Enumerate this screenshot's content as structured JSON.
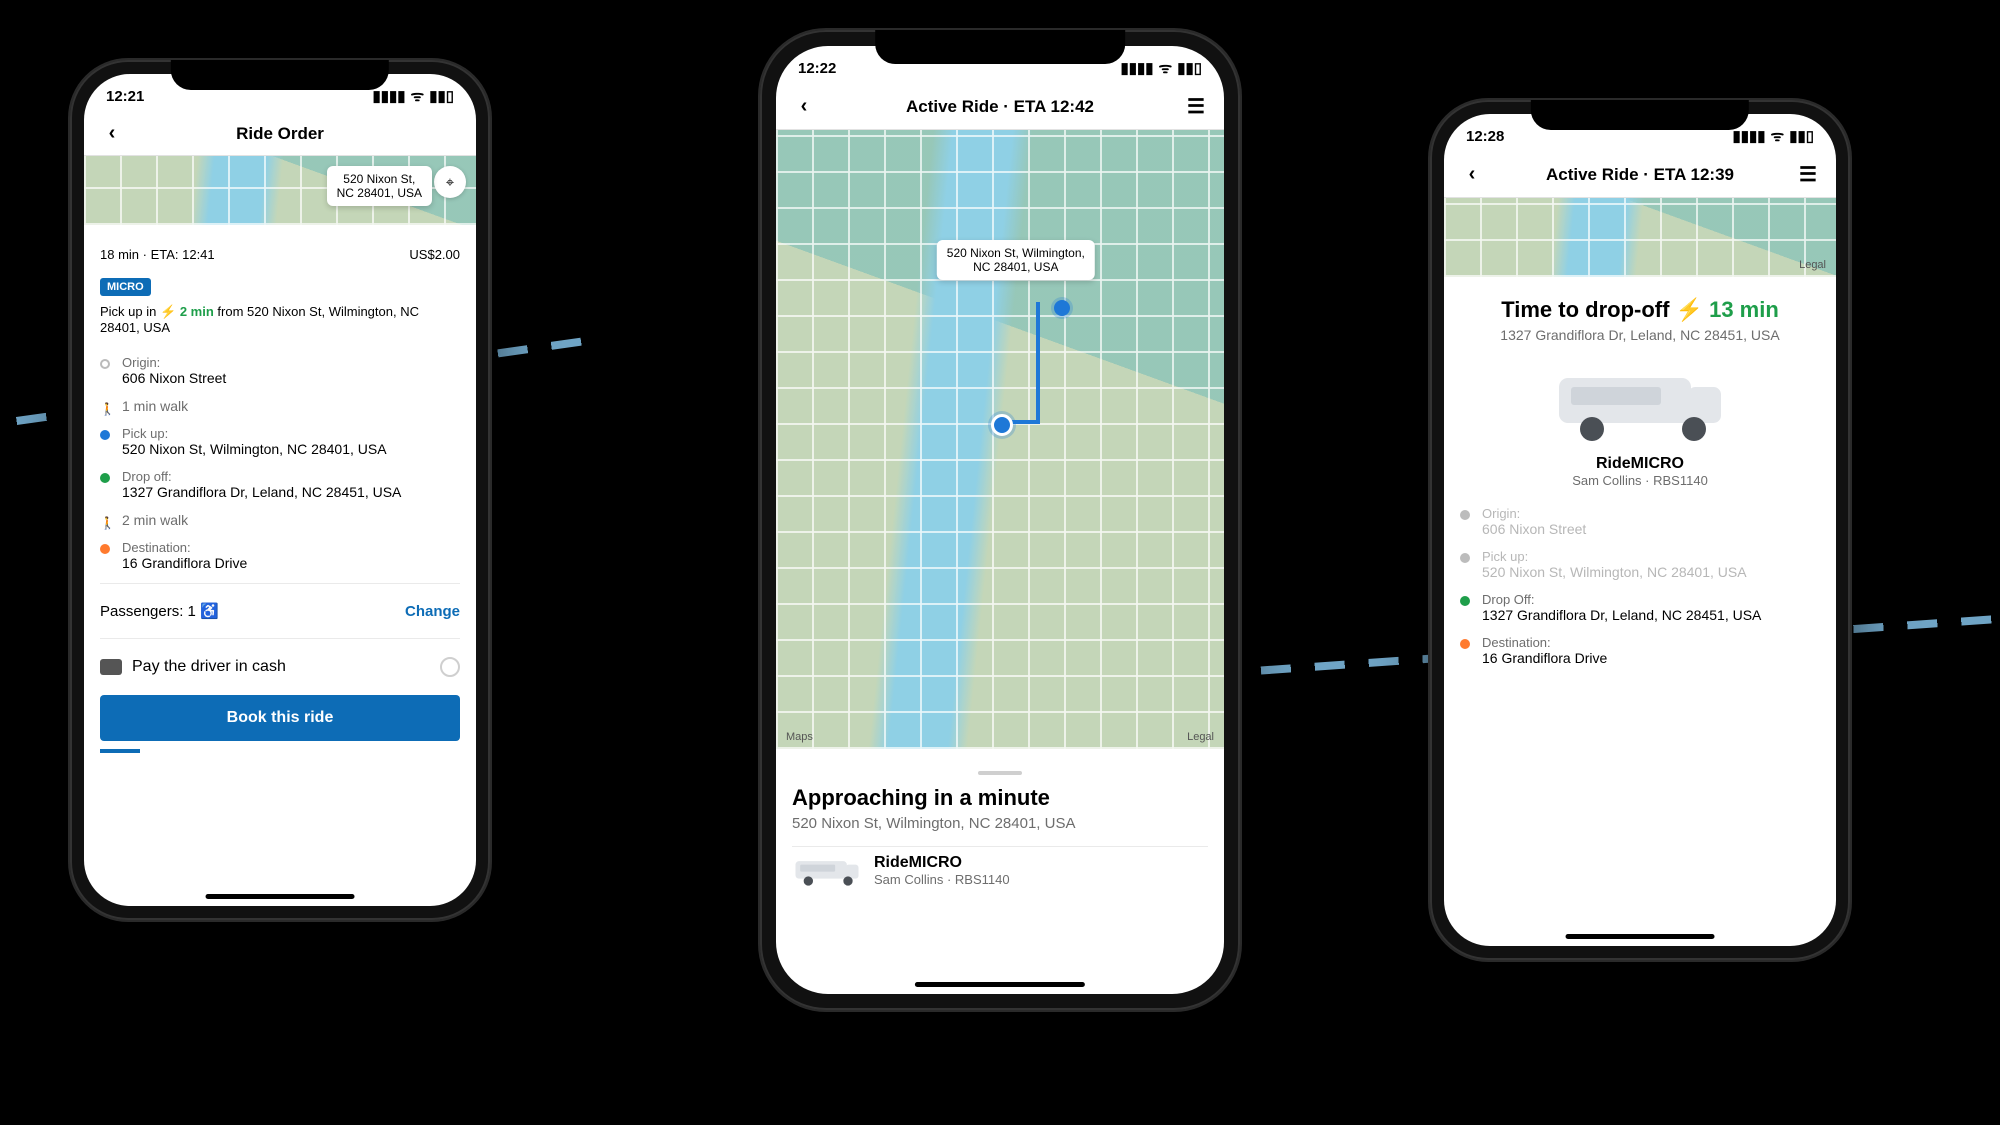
{
  "phones": {
    "order": {
      "time": "12:21",
      "title": "Ride Order",
      "map_callout": "520 Nixon St,\nNC 28401, USA",
      "eta_line_left": "18 min · ETA: 12:41",
      "price": "US$2.00",
      "chip": "MICRO",
      "pickup_prefix": "Pick up in",
      "pickup_eta": "2 min",
      "pickup_from": "from",
      "pickup_addr": "520 Nixon St, Wilmington, NC 28401, USA",
      "itin": {
        "origin_lbl": "Origin:",
        "origin": "606 Nixon Street",
        "walk1": "1 min walk",
        "pickup_lbl": "Pick up:",
        "pickup": "520 Nixon St, Wilmington, NC 28401, USA",
        "dropoff_lbl": "Drop off:",
        "dropoff": "1327 Grandiflora Dr, Leland, NC 28451, USA",
        "walk2": "2 min walk",
        "dest_lbl": "Destination:",
        "dest": "16 Grandiflora Drive"
      },
      "passengers_label": "Passengers: 1",
      "change": "Change",
      "pay_label": "Pay the driver in cash",
      "cta": "Book this ride"
    },
    "active": {
      "time": "12:22",
      "title": "Active Ride · ETA 12:42",
      "map_callout": "520 Nixon St, Wilmington,\nNC 28401, USA",
      "maps_brand": "Maps",
      "legal": "Legal",
      "sheet_title": "Approaching in a minute",
      "sheet_sub": "520 Nixon St, Wilmington, NC 28401, USA",
      "vehicle_name": "RideMICRO",
      "driver_line": "Sam Collins · RBS1140"
    },
    "dropoff": {
      "time": "12:28",
      "title": "Active Ride · ETA 12:39",
      "legal": "Legal",
      "card_title": "Time to drop-off",
      "card_eta": "13 min",
      "card_addr": "1327 Grandiflora Dr, Leland, NC 28451, USA",
      "vehicle_name": "RideMICRO",
      "driver_line": "Sam Collins · RBS1140",
      "itin": {
        "origin_lbl": "Origin:",
        "origin": "606 Nixon Street",
        "pickup_lbl": "Pick up:",
        "pickup": "520 Nixon St, Wilmington, NC 28401, USA",
        "dropoff_lbl": "Drop Off:",
        "dropoff": "1327 Grandiflora Dr, Leland, NC 28451, USA",
        "dest_lbl": "Destination:",
        "dest": "16 Grandiflora Drive"
      }
    }
  }
}
